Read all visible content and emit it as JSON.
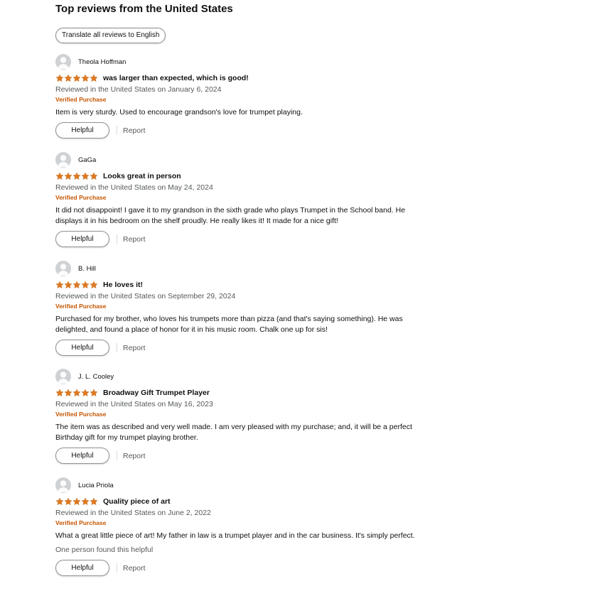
{
  "section": {
    "title": "Top reviews from the United States",
    "translate_label": "Translate all reviews to English"
  },
  "colors": {
    "star": "#de7921",
    "verified": "#c45500",
    "muted_text": "#565959"
  },
  "reviews": [
    {
      "name": "Theola Hoffman",
      "rating": 5,
      "title": "was larger than expected, which is good!",
      "date": "Reviewed in the United States on January 6, 2024",
      "verified": "Verified Purchase",
      "body": "Item is very sturdy. Used to encourage grandson's love for trumpet playing.",
      "helpful_label": "Helpful",
      "report_label": "Report"
    },
    {
      "name": "GaGa",
      "rating": 5,
      "title": "Looks great in person",
      "date": "Reviewed in the United States on May 24, 2024",
      "verified": "Verified Purchase",
      "body": "It did not disappoint! I gave it to my grandson in the sixth grade who plays Trumpet in the School band. He displays it in his bedroom on the shelf proudly. He really likes it! It made for a nice gift!",
      "helpful_label": "Helpful",
      "report_label": "Report"
    },
    {
      "name": "B. Hill",
      "rating": 5,
      "title": "He loves it!",
      "date": "Reviewed in the United States on September 29, 2024",
      "verified": "Verified Purchase",
      "body": "Purchased for my brother, who loves his trumpets more than pizza (and that's saying something). He was delighted, and found a place of honor for it in his music room. Chalk one up for sis!",
      "helpful_label": "Helpful",
      "report_label": "Report"
    },
    {
      "name": "J. L. Cooley",
      "rating": 5,
      "title": "Broadway Gift Trumpet Player",
      "date": "Reviewed in the United States on May 16, 2023",
      "verified": "Verified Purchase",
      "body": "The item was as described and very well made. I am very pleased with my purchase; and, it will be a perfect Birthday gift for my trumpet playing brother.",
      "helpful_label": "Helpful",
      "report_label": "Report"
    },
    {
      "name": "Lucia Priola",
      "rating": 5,
      "title": "Quality piece of art",
      "date": "Reviewed in the United States on June 2, 2022",
      "verified": "Verified Purchase",
      "body": "What a great little piece of art! My father in law is a trumpet player and in the car business. It's simply perfect.",
      "found_helpful": "One person found this helpful",
      "helpful_label": "Helpful",
      "report_label": "Report"
    }
  ]
}
